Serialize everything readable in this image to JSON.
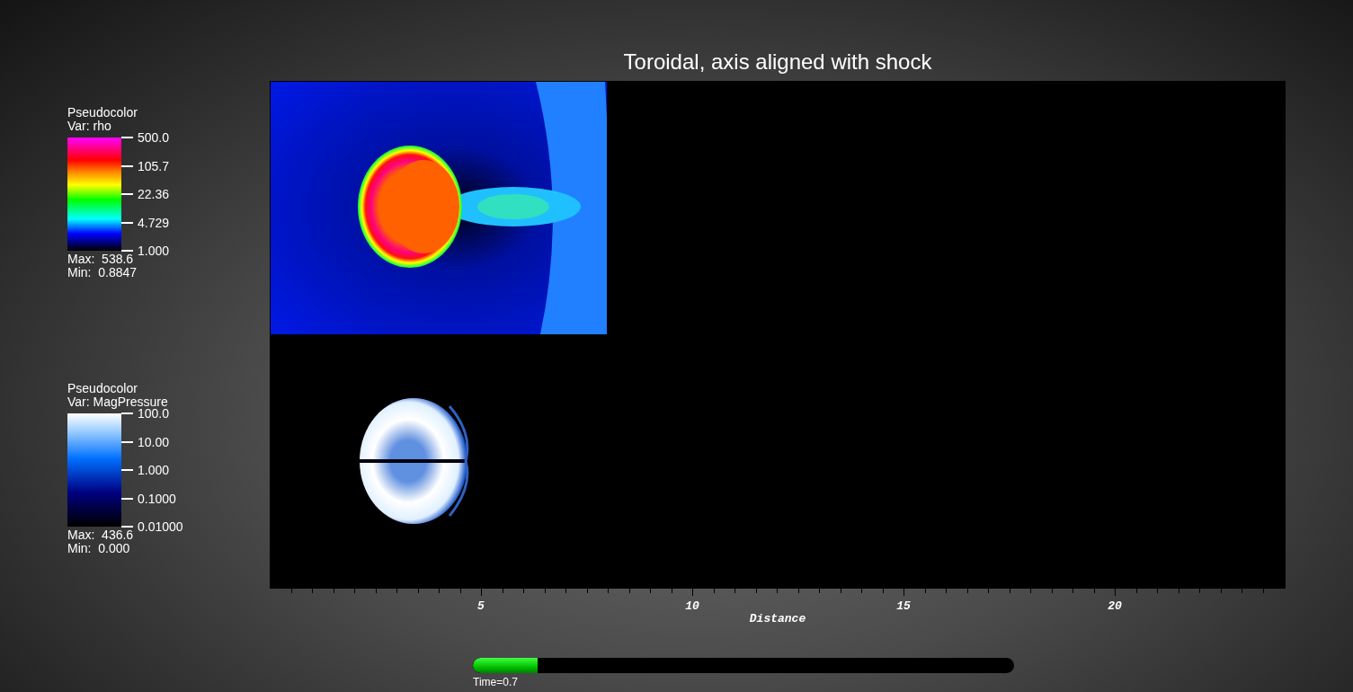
{
  "title": "Toroidal, axis aligned with shock",
  "legends": [
    {
      "plot_type": "Pseudocolor",
      "variable": "Var: rho",
      "kind": "rainbow",
      "ticks": [
        "500.0",
        "105.7",
        "22.36",
        "4.729",
        "1.000"
      ],
      "max": "Max:  538.6",
      "min": "Min:  0.8847"
    },
    {
      "plot_type": "Pseudocolor",
      "variable": "Var: MagPressure",
      "kind": "blue",
      "ticks": [
        "100.0",
        "10.00",
        "1.000",
        "0.1000",
        "0.01000"
      ],
      "max": "Max:  436.6",
      "min": "Min:  0.000"
    }
  ],
  "x_axis": {
    "title": "Distance",
    "tick_labels": [
      "5",
      "10",
      "15",
      "20"
    ]
  },
  "time_slider": {
    "label": "Time=0.7",
    "level": 0.12
  }
}
